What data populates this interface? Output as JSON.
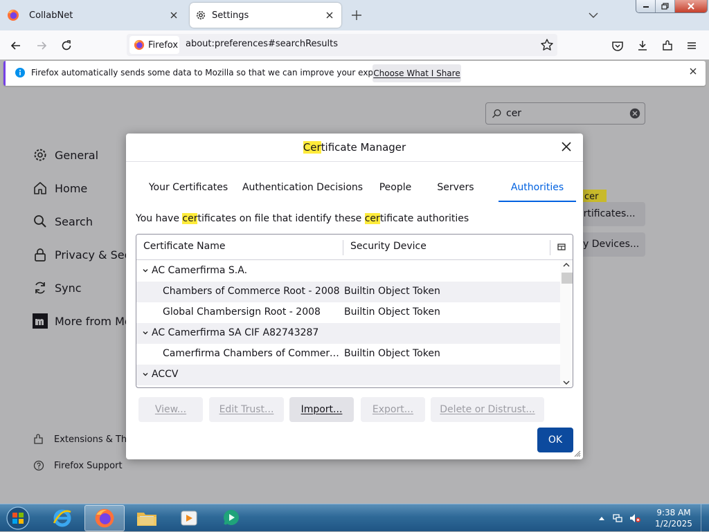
{
  "browser": {
    "tabs": [
      {
        "title": "CollabNet"
      },
      {
        "title": "Settings"
      }
    ],
    "identity_label": "Firefox",
    "url": "about:preferences#searchResults"
  },
  "notification": {
    "text": "Firefox automatically sends some data to Mozilla so that we can improve your experience.",
    "button_label": "Choose What I Share"
  },
  "settings": {
    "search_value": "cer",
    "sidebar": [
      {
        "label": "General",
        "icon": "gear-icon"
      },
      {
        "label": "Home",
        "icon": "home-icon"
      },
      {
        "label": "Search",
        "icon": "search-icon"
      },
      {
        "label": "Privacy & Secu",
        "icon": "lock-icon"
      },
      {
        "label": "Sync",
        "icon": "sync-icon"
      },
      {
        "label": "More from Mo",
        "icon": "mozilla-icon"
      }
    ],
    "footer": [
      {
        "label": "Extensions & The",
        "icon": "puzzle-icon"
      },
      {
        "label": "Firefox Support",
        "icon": "help-icon"
      }
    ],
    "bg_tag": "cer",
    "bg_button_1": "ertificates...",
    "bg_button_2": "y Devices..."
  },
  "dialog": {
    "title_highlight": "Cer",
    "title_rest": "tificate Manager",
    "tabs": [
      "Your Certificates",
      "Authentication Decisions",
      "People",
      "Servers",
      "Authorities"
    ],
    "active_tab": "Authorities",
    "desc": {
      "p1": "You have ",
      "h1": "cer",
      "p2": "tificates on file that identify these ",
      "h2": "cer",
      "p3": "tificate authorities"
    },
    "columns": [
      "Certificate Name",
      "Security Device"
    ],
    "rows": [
      {
        "type": "group",
        "name": "AC Camerfirma S.A."
      },
      {
        "type": "cert",
        "name": "Chambers of Commerce Root - 2008",
        "device": "Builtin Object Token"
      },
      {
        "type": "cert",
        "name": "Global Chambersign Root - 2008",
        "device": "Builtin Object Token"
      },
      {
        "type": "group",
        "name": "AC Camerfirma SA CIF A82743287"
      },
      {
        "type": "cert",
        "name": "Camerfirma Chambers of Commerce …",
        "device": "Builtin Object Token"
      },
      {
        "type": "group",
        "name": "ACCV"
      }
    ],
    "buttons": {
      "view": "View...",
      "edit_trust": "Edit Trust...",
      "import": "Import...",
      "export": "Export...",
      "delete": "Delete or Distrust...",
      "ok": "OK"
    }
  },
  "taskbar": {
    "time": "9:38 AM",
    "date": "1/2/2025"
  },
  "colors": {
    "accent": "#0061e0",
    "highlight": "#ffeb3b",
    "ok_button": "#0c4a9e",
    "notification_border": "#7542e5"
  }
}
